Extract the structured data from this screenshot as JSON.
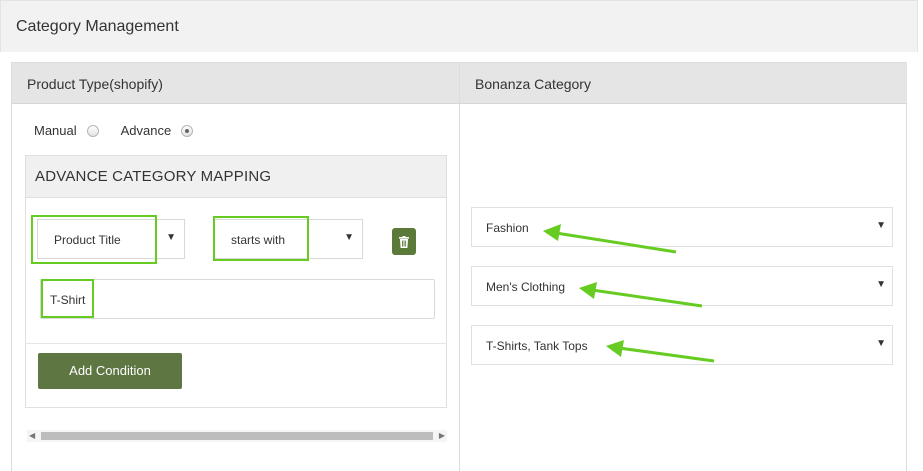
{
  "header": {
    "title": "Category Management"
  },
  "left": {
    "heading": "Product Type(shopify)",
    "radios": [
      {
        "label": "Manual",
        "checked": false
      },
      {
        "label": "Advance",
        "checked": true
      }
    ],
    "advance": {
      "heading": "ADVANCE CATEGORY MAPPING",
      "field_select": "Product Title",
      "operator_select": "starts with",
      "value_input": "T-Shirt",
      "add_condition_label": "Add Condition"
    }
  },
  "right": {
    "heading": "Bonanza Category",
    "selects": [
      "Fashion",
      "Men's Clothing",
      "T-Shirts, Tank Tops"
    ]
  },
  "colors": {
    "button_green": "#5e7641",
    "highlight_green": "#66cc22"
  },
  "icons": {
    "delete": "trash-icon",
    "dropdown": "caret-down-icon"
  }
}
